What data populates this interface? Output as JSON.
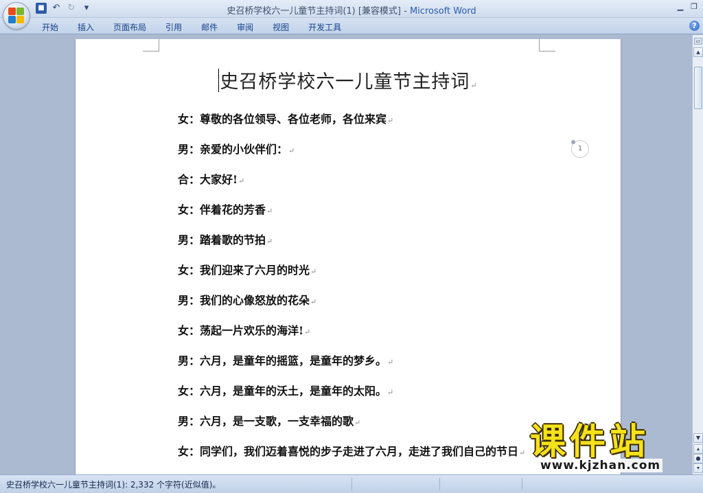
{
  "window": {
    "title": "史召桥学校六一儿童节主持词(1) [兼容模式] - ",
    "app_name": "Microsoft Word",
    "minimize": "▁",
    "restore": "❐",
    "help": "?"
  },
  "quick_access": {
    "save_icon": "save-icon",
    "undo_icon": "undo-icon",
    "redo_icon": "redo-icon",
    "customize_icon": "dropdown-icon"
  },
  "ribbon": {
    "tabs": [
      {
        "label": "开始"
      },
      {
        "label": "插入"
      },
      {
        "label": "页面布局"
      },
      {
        "label": "引用"
      },
      {
        "label": "邮件"
      },
      {
        "label": "审阅"
      },
      {
        "label": "视图"
      },
      {
        "label": "开发工具"
      }
    ]
  },
  "document": {
    "title": "史召桥学校六一儿童节主持词",
    "paragraph_mark": "↵",
    "comment_marker": "1",
    "lines": [
      "女：尊敬的各位领导、各位老师，各位来宾",
      "男：亲爱的小伙伴们：",
      "合：大家好!",
      "女：伴着花的芳香",
      "男：踏着歌的节拍",
      "女：我们迎来了六月的时光",
      "男：我们的心像怒放的花朵",
      "女：荡起一片欢乐的海洋!",
      "男：六月，是童年的摇篮，是童年的梦乡。",
      "女：六月，是童年的沃土，是童年的太阳。",
      "男：六月，是一支歌，一支幸福的歌",
      "女：同学们，我们迈着喜悦的步子走进了六月，走进了我们自己的节日"
    ]
  },
  "statusbar": {
    "text": "史召桥学校六一儿童节主持词(1): 2,332 个字符(近似值)。"
  },
  "watermark": {
    "cn": "课件站",
    "url": "www.kjzhan.com"
  },
  "colors": {
    "accent": "#2b5cae",
    "tab_text": "#15428b",
    "workspace": "#abbad0"
  }
}
